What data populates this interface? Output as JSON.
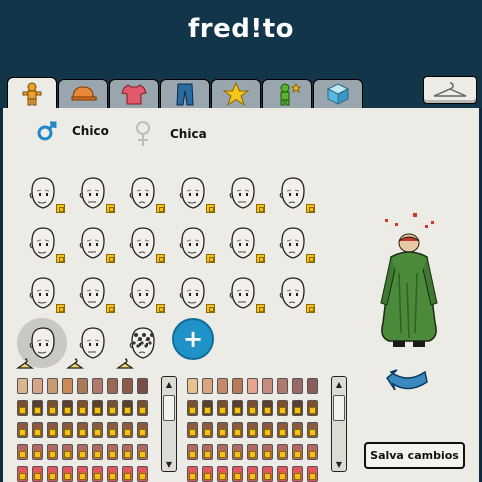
{
  "header": {
    "logo_text": "fred!to"
  },
  "tabs": [
    {
      "icon": "body-icon",
      "active": true
    },
    {
      "icon": "hat-icon",
      "active": false
    },
    {
      "icon": "shirt-icon",
      "active": false
    },
    {
      "icon": "pants-icon",
      "active": false
    },
    {
      "icon": "star-icon",
      "active": false
    },
    {
      "icon": "effects-icon",
      "active": false
    },
    {
      "icon": "cube-icon",
      "active": false
    }
  ],
  "wardrobe_button": {
    "icon": "hanger-icon"
  },
  "gender": {
    "male_label": "Chico",
    "female_label": "Chica",
    "selected": "male"
  },
  "face_grid": {
    "rows": 4,
    "cols": 6,
    "hc_badges": "club-icon",
    "selected_index": 18
  },
  "add_button_label": "+",
  "palette": {
    "colors_left": [
      "#d9b58e",
      "#d8a489",
      "#c99b73",
      "#c98a58",
      "#a9795a",
      "#b37a6b",
      "#9a6753",
      "#8b5a4a",
      "#7a4e46"
    ],
    "colors_right": [
      "#e7c48f",
      "#d9a680",
      "#c48b6a",
      "#b77a56",
      "#e8a58d",
      "#c68d7f",
      "#b07b6d",
      "#9a6a64",
      "#8a5d5a"
    ]
  },
  "save_button_label": "Salva cambios",
  "rotate_icon": "rotate-arrow-icon"
}
